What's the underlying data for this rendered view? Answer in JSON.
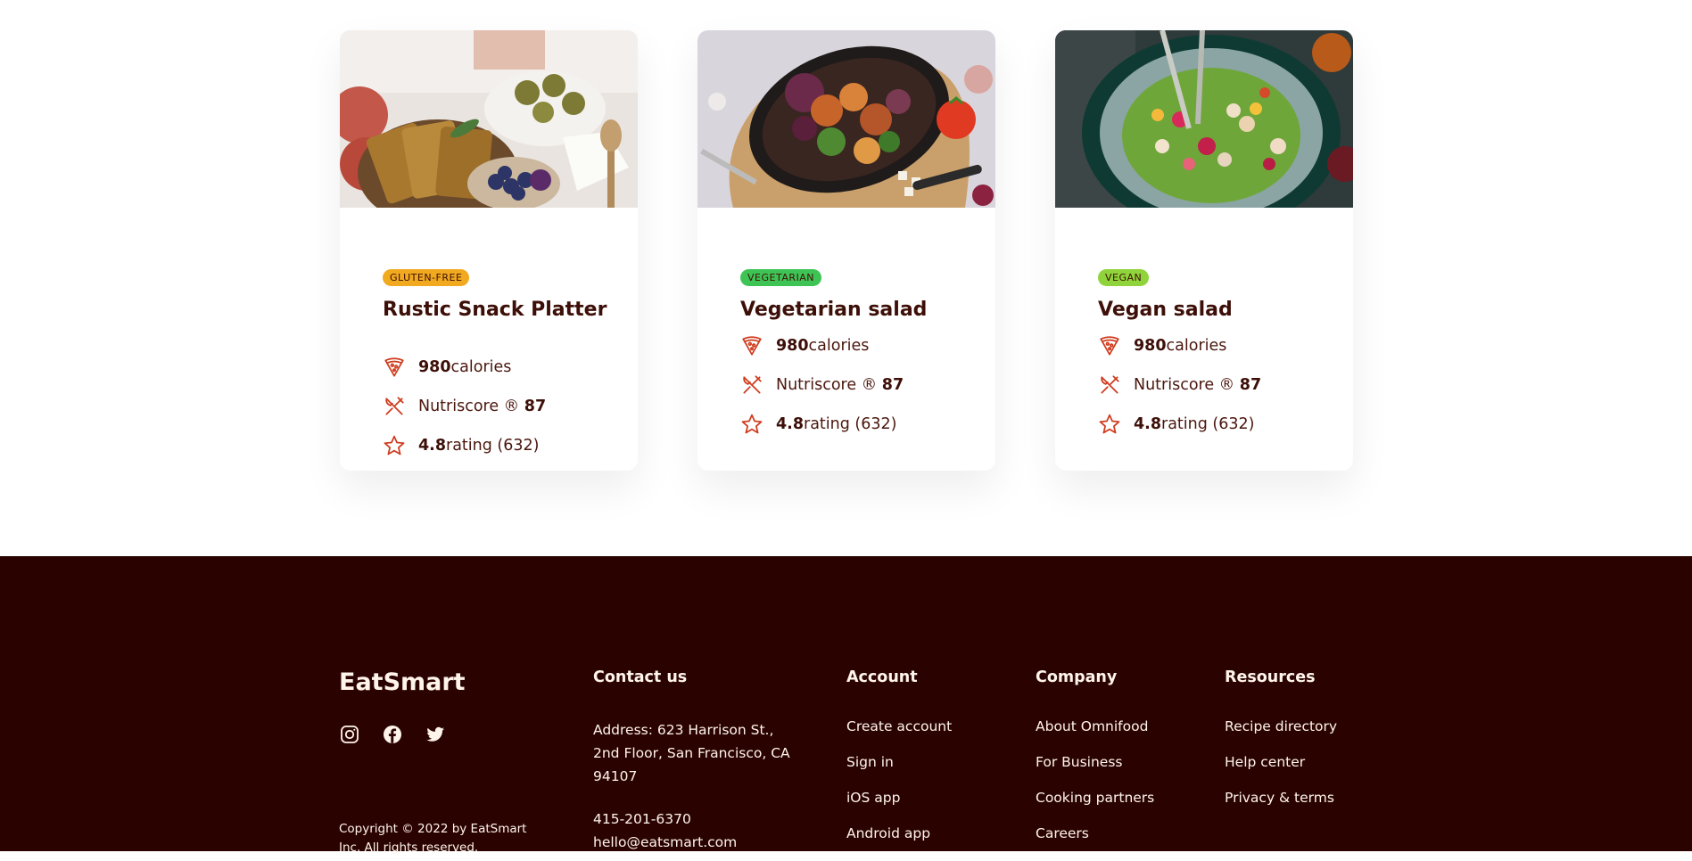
{
  "cards": [
    {
      "tag": "GLUTEN-FREE",
      "tag_color": "#f1a91f",
      "title": "Rustic Snack Platter",
      "calories_value": "980",
      "calories_unit": "calories",
      "nutri_label": "Nutriscore ®",
      "nutri_value": "87",
      "rating_value": "4.8",
      "rating_label": "rating (632)"
    },
    {
      "tag": "VEGETARIAN",
      "tag_color": "#3ec454",
      "title": "Vegetarian salad",
      "calories_value": "980",
      "calories_unit": "calories",
      "nutri_label": "Nutriscore ®",
      "nutri_value": "87",
      "rating_value": "4.8",
      "rating_label": "rating (632)"
    },
    {
      "tag": "VEGAN",
      "tag_color": "#8fd43a",
      "title": "Vegan salad",
      "calories_value": "980",
      "calories_unit": "calories",
      "nutri_label": "Nutriscore ®",
      "nutri_value": "87",
      "rating_value": "4.8",
      "rating_label": "rating (632)"
    }
  ],
  "footer": {
    "logo": "EatSmart",
    "socials": [
      "instagram-icon",
      "facebook-icon",
      "twitter-icon"
    ],
    "copyright": "Copyright © 2022 by EatSmart Inc. All rights reserved.",
    "contact": {
      "heading": "Contact us",
      "address": "Address: 623 Harrison St., 2nd Floor, San Francisco, CA 94107",
      "phone": "415-201-6370",
      "email": "hello@eatsmart.com"
    },
    "account": {
      "heading": "Account",
      "links": [
        "Create account",
        "Sign in",
        "iOS app",
        "Android app"
      ]
    },
    "company": {
      "heading": "Company",
      "links": [
        "About Omnifood",
        "For Business",
        "Cooking partners",
        "Careers"
      ]
    },
    "resources": {
      "heading": "Resources",
      "links": [
        "Recipe directory",
        "Help center",
        "Privacy & terms"
      ]
    }
  },
  "colors": {
    "accent_icon": "#cf3a1c",
    "footer_bg": "#2a0300",
    "text_dark": "#3d0f08"
  }
}
